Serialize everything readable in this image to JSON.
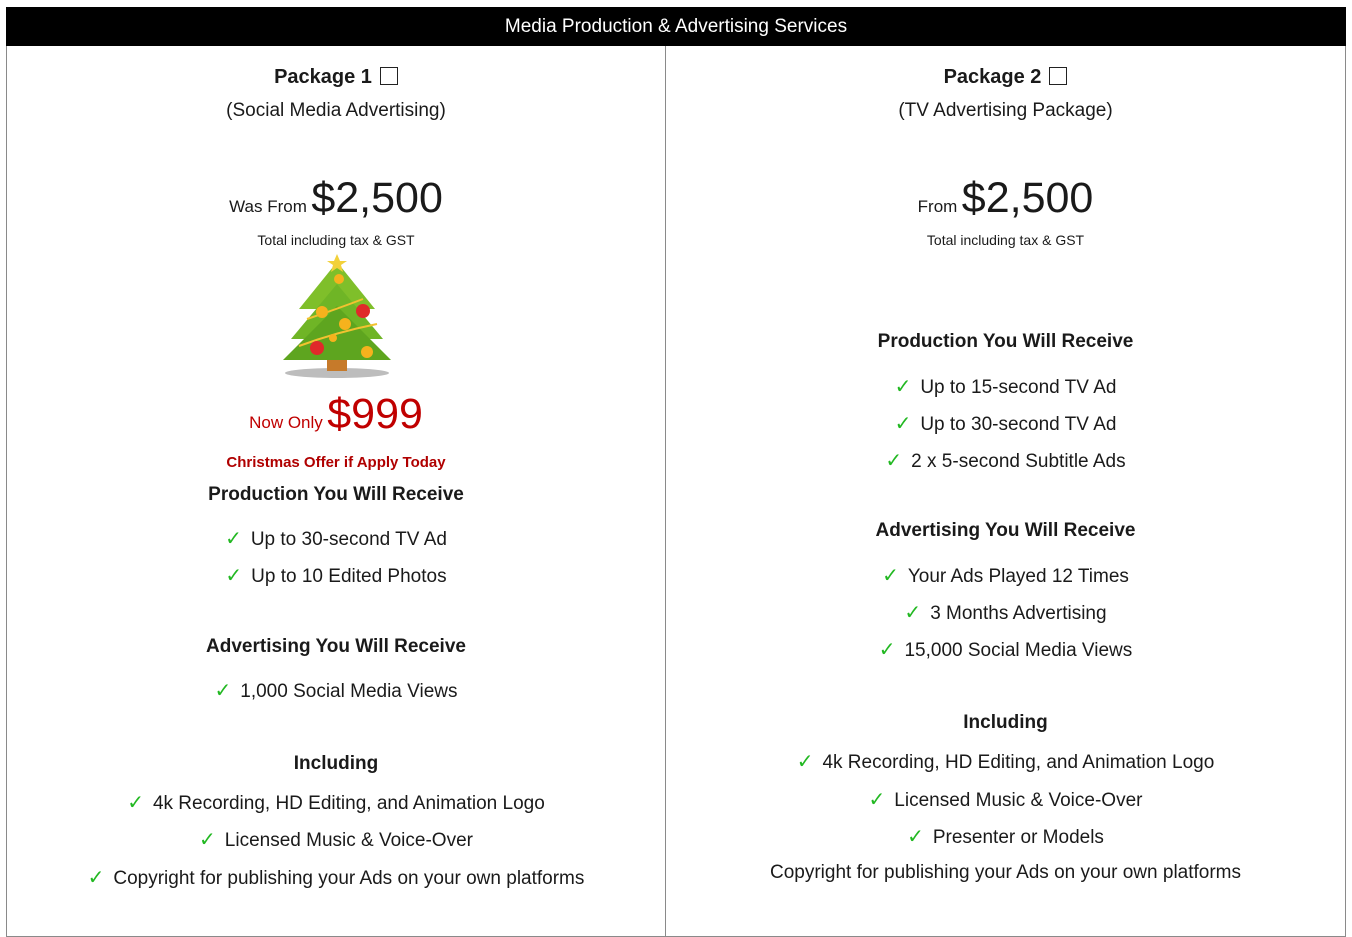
{
  "header": {
    "title": "Media Production & Advertising Services"
  },
  "package1": {
    "title": "Package 1",
    "subtitle": "(Social Media Advertising)",
    "price_prefix": "Was From",
    "price": "$2,500",
    "tax_note": "Total including tax & GST",
    "promo_prefix": "Now Only",
    "promo_price": "$999",
    "offer": "Christmas Offer if Apply Today",
    "production_heading": "Production You Will Receive",
    "production_items": [
      "Up to 30-second TV Ad",
      "Up to 10 Edited Photos"
    ],
    "advertising_heading": "Advertising You Will Receive",
    "advertising_items": [
      "1,000 Social Media Views"
    ],
    "including_heading": "Including",
    "including_items": [
      "4k Recording, HD Editing, and Animation Logo",
      "Licensed Music & Voice-Over",
      "Copyright for publishing your Ads on your own platforms"
    ]
  },
  "package2": {
    "title": "Package 2",
    "subtitle": "(TV Advertising Package)",
    "price_prefix": "From",
    "price": "$2,500",
    "tax_note": "Total including tax & GST",
    "production_heading": "Production You Will Receive",
    "production_items": [
      "Up to 15-second TV Ad",
      "Up to 30-second TV Ad",
      "2 x 5-second Subtitle Ads"
    ],
    "advertising_heading": "Advertising You Will Receive",
    "advertising_items": [
      "Your Ads Played 12 Times",
      "3 Months Advertising",
      "15,000 Social Media Views"
    ],
    "including_heading": "Including",
    "including_items": [
      "4k Recording, HD Editing, and Animation Logo",
      "Licensed Music & Voice-Over",
      "Presenter or Models",
      "Copyright for publishing your Ads on your own platforms"
    ]
  },
  "icons": {
    "check": "checkmark-icon",
    "tree": "christmas-tree-icon",
    "box": "checkbox-icon"
  },
  "colors": {
    "header_bg": "#000000",
    "check": "#22b822",
    "promo": "#c00000"
  }
}
